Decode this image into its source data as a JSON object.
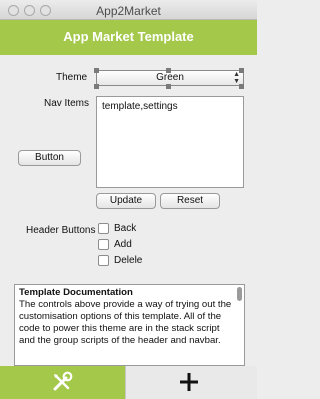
{
  "window": {
    "title": "App2Market"
  },
  "header": {
    "title": "App Market Template"
  },
  "theme": {
    "label": "Theme",
    "value": "Green",
    "arrows_up": "▲",
    "arrows_down": "▼"
  },
  "nav": {
    "label": "Nav Items",
    "value": "template,settings"
  },
  "button": {
    "label": "Button"
  },
  "actions": {
    "update": "Update",
    "reset": "Reset"
  },
  "header_buttons": {
    "label": "Header Buttons",
    "options": [
      "Back",
      "Add",
      "Delele"
    ]
  },
  "doc": {
    "title": "Template Documentation",
    "body": "The controls above provide a way of trying out the customisation options of this template. All of the code to power this theme are in the stack script and the group scripts of the header and navbar."
  },
  "tabs": {
    "left_icon": "tools-icon",
    "right_icon": "plus-icon"
  },
  "colors": {
    "accent": "#a3c84a",
    "header_text": "#ffffff"
  }
}
